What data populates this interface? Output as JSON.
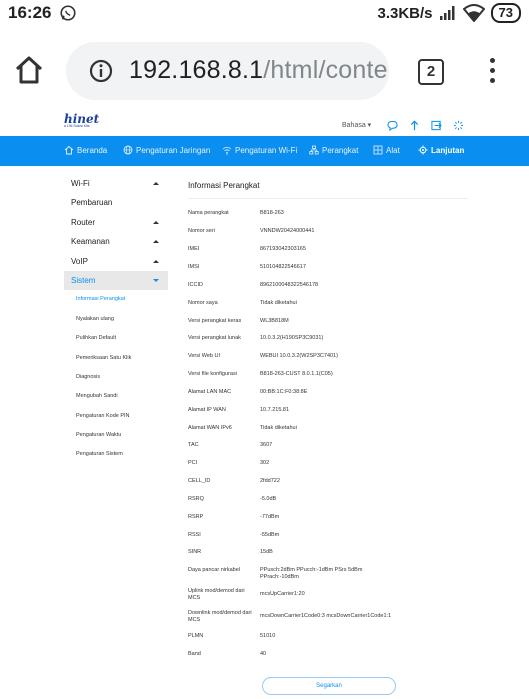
{
  "status_bar": {
    "time": "16:26",
    "speed": "3.3KB/s",
    "battery": "73",
    "icons": [
      "whatsapp-icon",
      "signal-icon",
      "wifi-icon",
      "battery-icon"
    ]
  },
  "browser": {
    "url_main": "192.168.8.1",
    "url_rest": "/html/conte",
    "tab_count": "2",
    "icons": [
      "home-icon",
      "info-icon",
      "tabs-icon",
      "menu-icon"
    ]
  },
  "router": {
    "logo": "hinet",
    "logo_sub": "a LIN Solusi Kits",
    "language": "Bahasa ▾",
    "accent_color": "#0a8ff0",
    "nav": [
      {
        "label": "Beranda",
        "icon": "home-icon"
      },
      {
        "label": "Pengaturan Jaringan",
        "icon": "globe-icon"
      },
      {
        "label": "Pengaturan Wi-Fi",
        "icon": "wifi-icon"
      },
      {
        "label": "Perangkat",
        "icon": "devices-icon"
      },
      {
        "label": "Alat",
        "icon": "tools-icon"
      },
      {
        "label": "Lanjutan",
        "icon": "gear-icon"
      }
    ],
    "sidebar": [
      {
        "label": "Wi-Fi"
      },
      {
        "label": "Pembaruan"
      },
      {
        "label": "Router"
      },
      {
        "label": "Keamanan"
      },
      {
        "label": "VoIP"
      },
      {
        "label": "Sistem"
      }
    ],
    "subnav": [
      "Informasi Perangkat",
      "Nyalakan ulang",
      "Pulihkan Default",
      "Pemeriksaan Satu Klik",
      "Diagnosis",
      "Mengubah Sandi",
      "Pengaturan Kode PIN",
      "Pengaturan Waktu",
      "Pengaturan Sistem"
    ],
    "content_title": "Informasi Perangkat",
    "rows": [
      {
        "label": "Nama perangkat",
        "value": "B818-263"
      },
      {
        "label": "Nomor seri",
        "value": "VNNDW20424000441"
      },
      {
        "label": "IMEI",
        "value": "867193042303165"
      },
      {
        "label": "IMSI",
        "value": "510104822546617"
      },
      {
        "label": "ICCID",
        "value": "8962100048322546178"
      },
      {
        "label": "Nomor saya",
        "value": "Tidak diketahui"
      },
      {
        "label": "Versi perangkat keras",
        "value": "WL3B818M"
      },
      {
        "label": "Versi perangkat lunak",
        "value": "10.0.3.2(H190SP3C9031)"
      },
      {
        "label": "Versi Web UI",
        "value": "WEBUI 10.0.3.2(W2SP3C7401)"
      },
      {
        "label": "Versi file konfigurasi",
        "value": "B818-263-CUST 8.0.1.1(C05)"
      },
      {
        "label": "Alamat LAN MAC",
        "value": "00:BB:1C:F0:38:8E"
      },
      {
        "label": "Alamat IP WAN",
        "value": "10.7.215.81"
      },
      {
        "label": "Alamat WAN IPv6",
        "value": "Tidak diketahui"
      },
      {
        "label": "TAC",
        "value": "3607"
      },
      {
        "label": "PCI",
        "value": "302"
      },
      {
        "label": "CELL_ID",
        "value": "2fdd722"
      },
      {
        "label": "RSRQ",
        "value": "-5.0dB"
      },
      {
        "label": "RSRP",
        "value": "-77dBm"
      },
      {
        "label": "RSSI",
        "value": "-55dBm"
      },
      {
        "label": "SINR",
        "value": "15dB"
      },
      {
        "label": "Daya pancar nirkabel",
        "value": "PPusch:2dBm PPucch:-1dBm PSrs 5dBm",
        "value2": "PPrach:-10dBm"
      },
      {
        "label": "Uplink mod/demod dari",
        "label2": "MCS",
        "value": "mcsUpCarrier1:20"
      },
      {
        "label": "Downlink mod/demod dari",
        "label2": "MCS",
        "value": "mcsDownCarrier1Code0:3 mcsDownCarrier1Code1:1"
      },
      {
        "label": "PLMN",
        "value": "51010"
      },
      {
        "label": "Band",
        "value": "40"
      }
    ],
    "save_label": "Segarkan"
  }
}
